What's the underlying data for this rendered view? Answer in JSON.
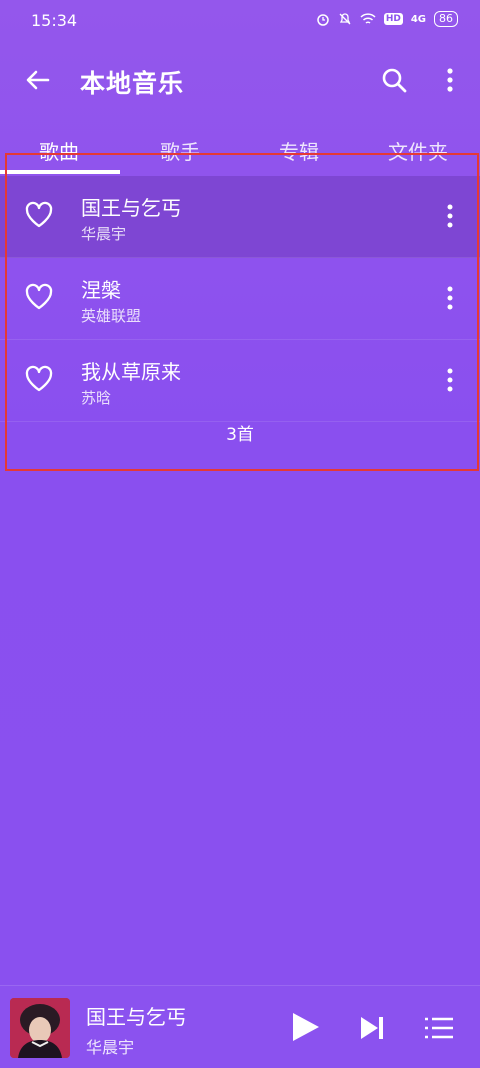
{
  "status": {
    "time": "15:34",
    "net": "4G",
    "hd": "HD",
    "battery": "86"
  },
  "header": {
    "title": "本地音乐"
  },
  "tabs": [
    "歌曲",
    "歌手",
    "专辑",
    "文件夹"
  ],
  "songs": [
    {
      "title": "国王与乞丐",
      "artist": "华晨宇"
    },
    {
      "title": "涅槃",
      "artist": "英雄联盟"
    },
    {
      "title": "我从草原来",
      "artist": "苏晗"
    }
  ],
  "footer": {
    "count": "3首"
  },
  "player": {
    "title": "国王与乞丐",
    "artist": "华晨宇"
  },
  "colors": {
    "background": "#8a50ef",
    "active_row": "#7e46d3",
    "highlight": "#e53935"
  }
}
